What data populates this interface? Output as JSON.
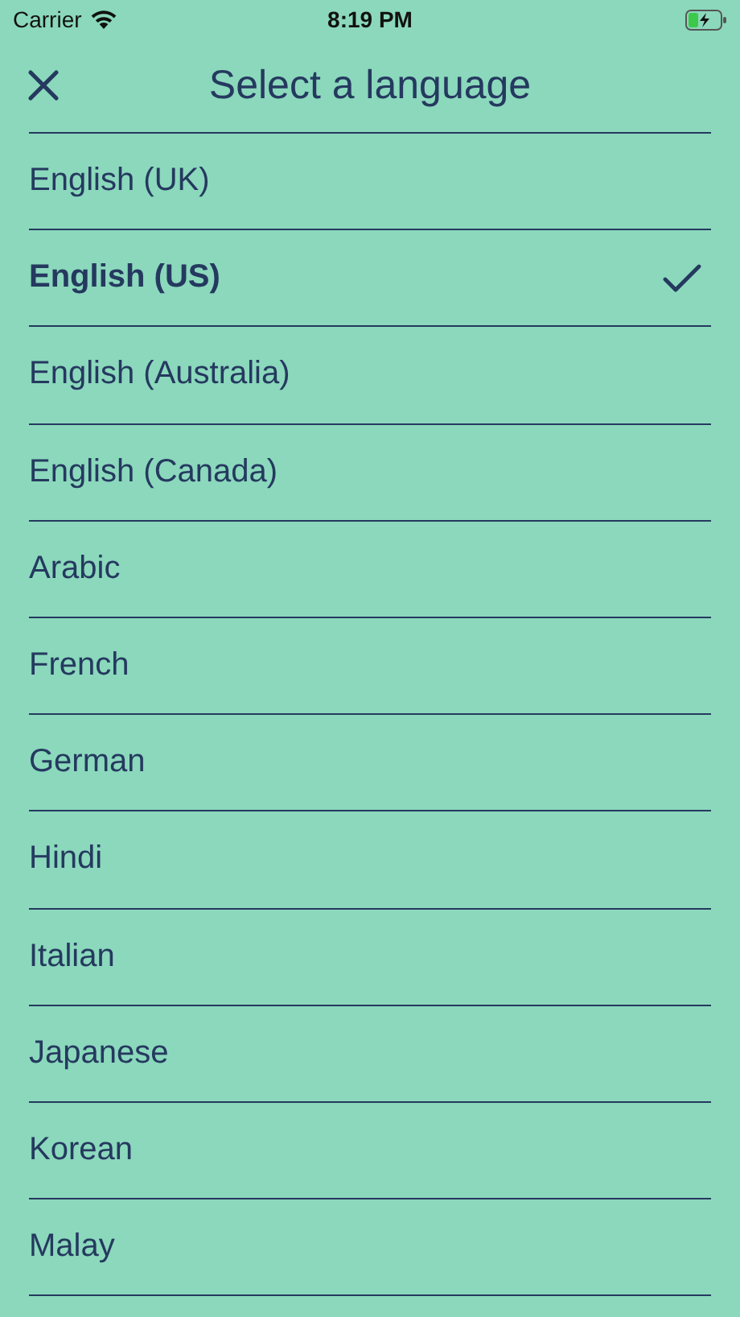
{
  "status_bar": {
    "carrier": "Carrier",
    "time": "8:19 PM"
  },
  "header": {
    "title": "Select a language"
  },
  "languages": [
    {
      "label": "English (UK)",
      "selected": false
    },
    {
      "label": "English (US)",
      "selected": true
    },
    {
      "label": "English (Australia)",
      "selected": false
    },
    {
      "label": "English (Canada)",
      "selected": false
    },
    {
      "label": "Arabic",
      "selected": false
    },
    {
      "label": "French",
      "selected": false
    },
    {
      "label": "German",
      "selected": false
    },
    {
      "label": "Hindi",
      "selected": false
    },
    {
      "label": "Italian",
      "selected": false
    },
    {
      "label": "Japanese",
      "selected": false
    },
    {
      "label": "Korean",
      "selected": false
    },
    {
      "label": "Malay",
      "selected": false
    }
  ]
}
